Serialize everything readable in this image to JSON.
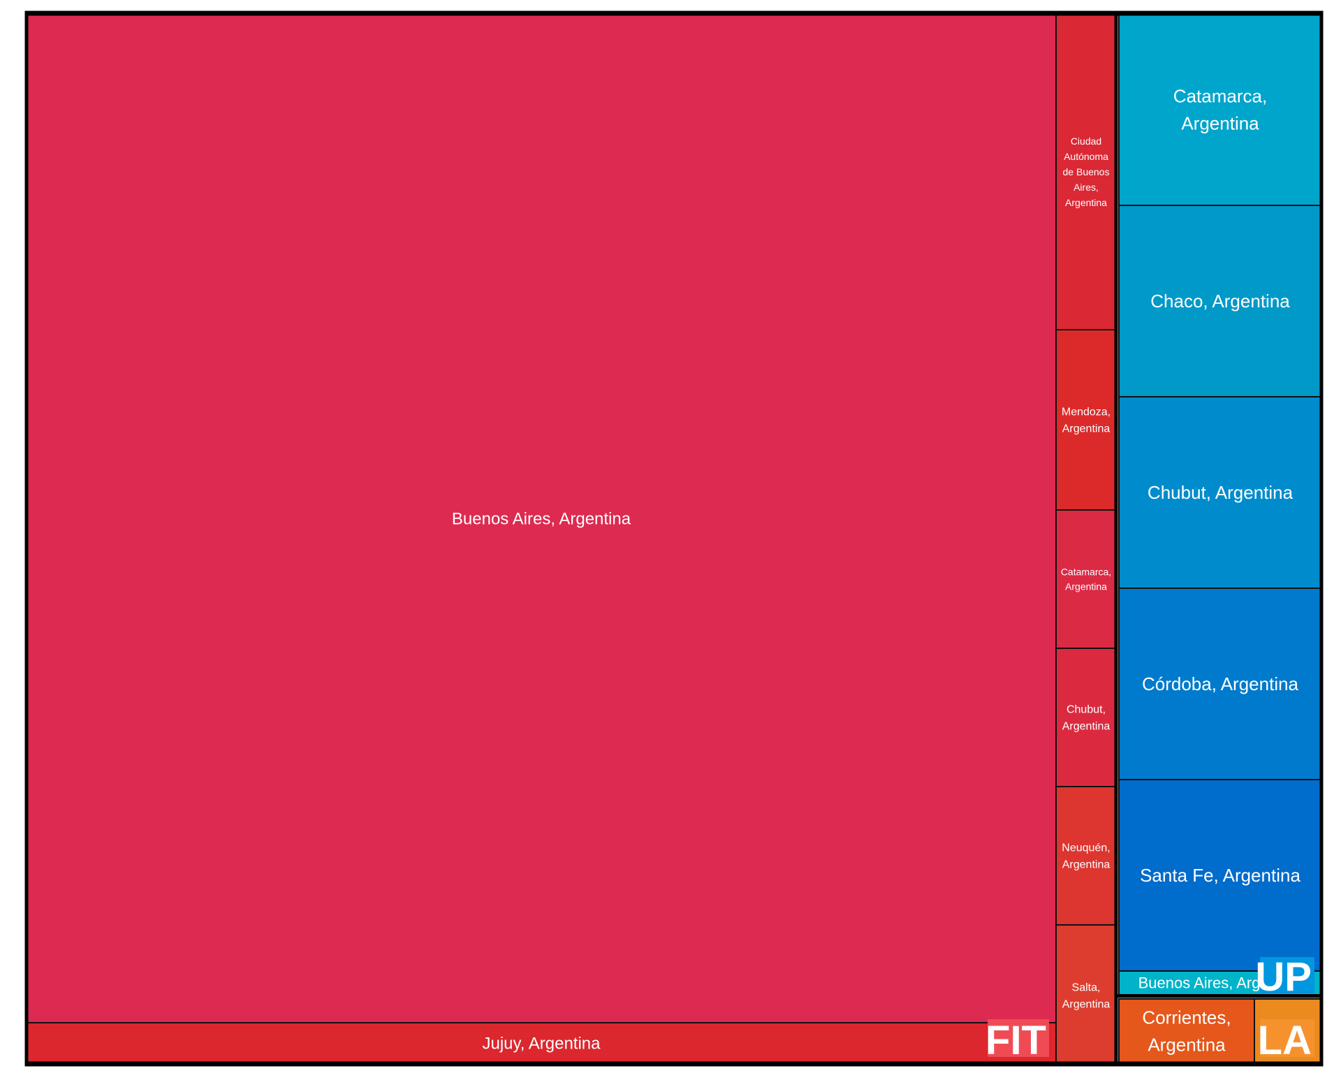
{
  "chart_data": {
    "type": "treemap",
    "groups": [
      {
        "name": "FIT",
        "label_color": "#F04B55",
        "cells": [
          {
            "label": "Buenos Aires, Argentina",
            "color": "#DD2A50"
          },
          {
            "label": "Jujuy, Argentina",
            "color": "#DB272D"
          },
          {
            "label": "Ciudad Autónoma de Buenos Aires, Argentina",
            "color": "#DA2835"
          },
          {
            "label": "Mendoza, Argentina",
            "color": "#DC2A2A"
          },
          {
            "label": "Catamarca, Argentina",
            "color": "#DB2A44"
          },
          {
            "label": "Chubut, Argentina",
            "color": "#DB2A40"
          },
          {
            "label": "Neuquén, Argentina",
            "color": "#DD3530"
          },
          {
            "label": "Salta, Argentina",
            "color": "#DD3D2E"
          }
        ]
      },
      {
        "name": "UP",
        "label_color": "#0096E0",
        "cells": [
          {
            "label": "Catamarca, Argentina",
            "color": "#00A5CC"
          },
          {
            "label": "Chaco, Argentina",
            "color": "#0099C8"
          },
          {
            "label": "Chubut, Argentina",
            "color": "#008CCC"
          },
          {
            "label": "Córdoba, Argentina",
            "color": "#007ACC"
          },
          {
            "label": "Santa Fe, Argentina",
            "color": "#006CCC"
          },
          {
            "label": "Buenos Aires, Argentina",
            "color": "#00B3C9"
          }
        ]
      },
      {
        "name": "LA",
        "label_color": "#F5922E",
        "cells": [
          {
            "label": "Corrientes, Argentina",
            "color": "#E5571B"
          },
          {
            "label": "",
            "color": "#EB8A1F"
          }
        ]
      }
    ]
  }
}
